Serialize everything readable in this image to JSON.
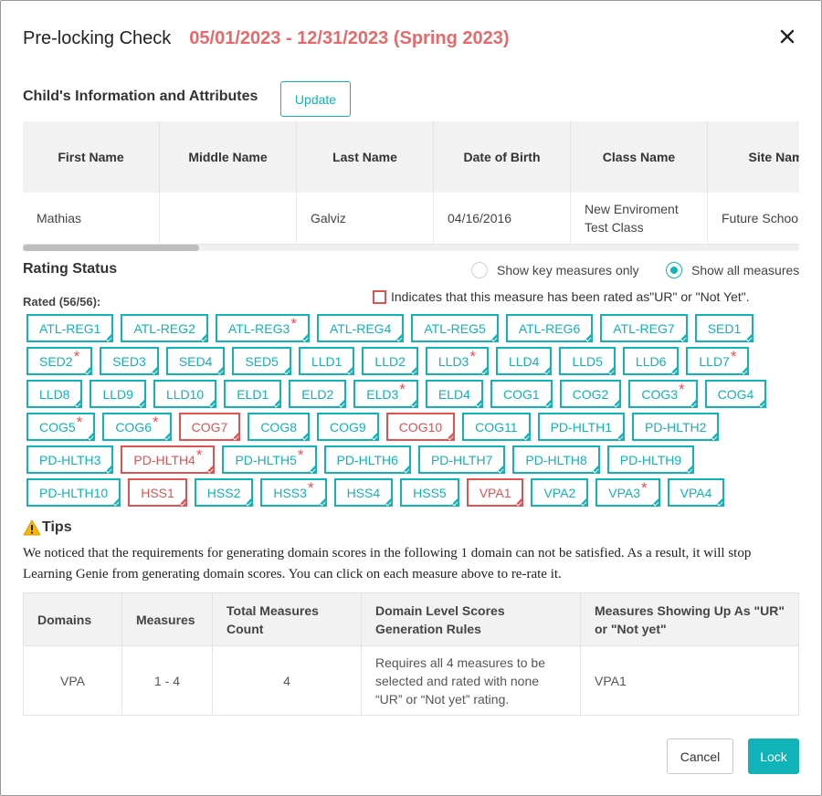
{
  "header": {
    "title": "Pre-locking Check",
    "date_range": "05/01/2023 - 12/31/2023 (Spring 2023)"
  },
  "child_info": {
    "section_title": "Child's Information and Attributes",
    "update_label": "Update",
    "columns": [
      "First Name",
      "Middle Name",
      "Last Name",
      "Date of Birth",
      "Class Name",
      "Site Nam"
    ],
    "row": [
      "Mathias",
      "",
      "Galviz",
      "04/16/2016",
      "New Enviroment Test Class",
      "Future Schoo"
    ]
  },
  "rating_status": {
    "section_title": "Rating Status",
    "option_key": "Show key measures only",
    "option_all": "Show all measures",
    "selected": "all",
    "rated_label": "Rated (56/56):",
    "legend_text": "Indicates that this measure has been rated as\"UR\" or \"Not Yet\".",
    "chip_rows": [
      [
        {
          "label": "ATL-REG1"
        },
        {
          "label": "ATL-REG2"
        },
        {
          "label": "ATL-REG3",
          "star": true
        },
        {
          "label": "ATL-REG4"
        },
        {
          "label": "ATL-REG5"
        },
        {
          "label": "ATL-REG6"
        },
        {
          "label": "ATL-REG7"
        },
        {
          "label": "SED1"
        }
      ],
      [
        {
          "label": "SED2",
          "star": true
        },
        {
          "label": "SED3"
        },
        {
          "label": "SED4"
        },
        {
          "label": "SED5"
        },
        {
          "label": "LLD1"
        },
        {
          "label": "LLD2"
        },
        {
          "label": "LLD3",
          "star": true
        },
        {
          "label": "LLD4"
        },
        {
          "label": "LLD5"
        },
        {
          "label": "LLD6"
        },
        {
          "label": "LLD7",
          "star": true
        }
      ],
      [
        {
          "label": "LLD8"
        },
        {
          "label": "LLD9"
        },
        {
          "label": "LLD10"
        },
        {
          "label": "ELD1"
        },
        {
          "label": "ELD2"
        },
        {
          "label": "ELD3",
          "star": true
        },
        {
          "label": "ELD4"
        },
        {
          "label": "COG1"
        },
        {
          "label": "COG2"
        },
        {
          "label": "COG3",
          "star": true
        },
        {
          "label": "COG4"
        }
      ],
      [
        {
          "label": "COG5",
          "star": true
        },
        {
          "label": "COG6",
          "star": true
        },
        {
          "label": "COG7",
          "red": true
        },
        {
          "label": "COG8"
        },
        {
          "label": "COG9"
        },
        {
          "label": "COG10",
          "red": true
        },
        {
          "label": "COG11"
        },
        {
          "label": "PD-HLTH1"
        },
        {
          "label": "PD-HLTH2"
        }
      ],
      [
        {
          "label": "PD-HLTH3"
        },
        {
          "label": "PD-HLTH4",
          "red": true,
          "star": true
        },
        {
          "label": "PD-HLTH5",
          "star": true
        },
        {
          "label": "PD-HLTH6"
        },
        {
          "label": "PD-HLTH7"
        },
        {
          "label": "PD-HLTH8"
        },
        {
          "label": "PD-HLTH9"
        }
      ],
      [
        {
          "label": "PD-HLTH10"
        },
        {
          "label": "HSS1",
          "red": true
        },
        {
          "label": "HSS2"
        },
        {
          "label": "HSS3",
          "star": true
        },
        {
          "label": "HSS4"
        },
        {
          "label": "HSS5"
        },
        {
          "label": "VPA1",
          "red": true
        },
        {
          "label": "VPA2"
        },
        {
          "label": "VPA3",
          "star": true
        },
        {
          "label": "VPA4"
        }
      ]
    ]
  },
  "tips": {
    "icon": "warning-icon",
    "title": "Tips",
    "text": "We noticed that the requirements for generating domain scores in the following 1 domain can not be satisfied. As a result, it will stop Learning Genie from generating domain scores. You can click on each measure above to re-rate it."
  },
  "domain_table": {
    "columns": [
      "Domains",
      "Measures",
      "Total Measures Count",
      "Domain Level Scores Generation Rules",
      "Measures Showing Up As \"UR\" or \"Not yet\""
    ],
    "rows": [
      [
        "VPA",
        "1 - 4",
        "4",
        "Requires all 4 measures to be selected and rated with none “UR” or “Not yet” rating.",
        "VPA1"
      ]
    ]
  },
  "footer": {
    "cancel_label": "Cancel",
    "lock_label": "Lock"
  },
  "colors": {
    "accent": "#10b3b7",
    "alert": "#e05353",
    "date_range": "#e8696b"
  }
}
